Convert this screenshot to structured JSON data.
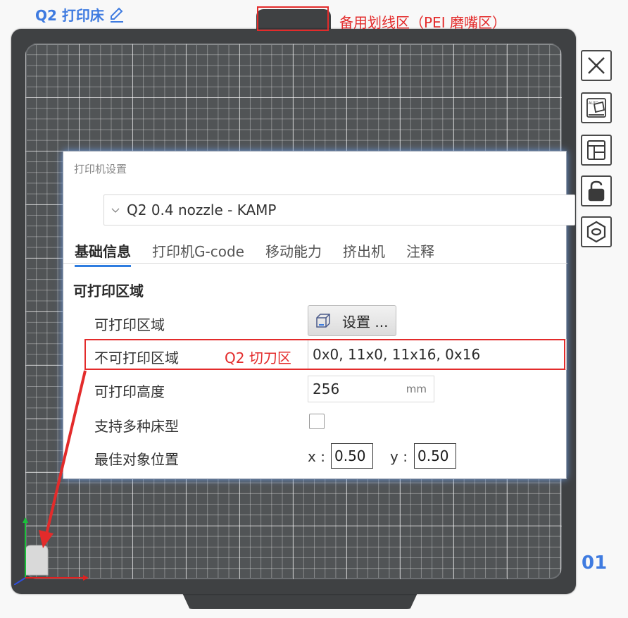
{
  "bed": {
    "title": "Q2 打印床",
    "plate_number": "01"
  },
  "annotations": {
    "top_caption": "备用划线区（PEI 磨嘴区）",
    "excluded_caption": "Q2 切刀区",
    "highlight_color": "#e32b2b"
  },
  "toolbar": {
    "icons": [
      "close-icon",
      "auto-arrange-icon",
      "layout-icon",
      "lock-icon",
      "hex-nut-icon"
    ]
  },
  "dialog": {
    "title": "打印机设置",
    "preset": "Q2 0.4 nozzle - KAMP",
    "tabs": [
      {
        "label": "基础信息",
        "active": true
      },
      {
        "label": "打印机G-code",
        "active": false
      },
      {
        "label": "移动能力",
        "active": false
      },
      {
        "label": "挤出机",
        "active": false
      },
      {
        "label": "注释",
        "active": false
      }
    ],
    "section_title": "可打印区域",
    "rows": {
      "printable_area": {
        "label": "可打印区域",
        "button": "设置 ..."
      },
      "excluded_area": {
        "label": "不可打印区域",
        "value": "0x0, 11x0, 11x16, 0x16"
      },
      "printable_height": {
        "label": "可打印高度",
        "value": "256",
        "unit": "mm"
      },
      "multi_bed_types": {
        "label": "支持多种床型",
        "checked": false
      },
      "best_object_position": {
        "label": "最佳对象位置",
        "x_label": "x :",
        "x_value": "0.50",
        "y_label": "y :",
        "y_value": "0.50"
      }
    }
  }
}
